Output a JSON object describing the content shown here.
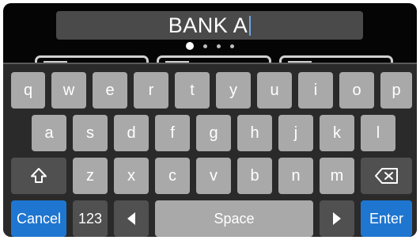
{
  "input": {
    "value": "BANK A"
  },
  "pagination": {
    "total": 4,
    "active": 1
  },
  "keyboard": {
    "row1": [
      "q",
      "w",
      "e",
      "r",
      "t",
      "y",
      "u",
      "i",
      "o",
      "p"
    ],
    "row2": [
      "a",
      "s",
      "d",
      "f",
      "g",
      "h",
      "j",
      "k",
      "l"
    ],
    "row3": [
      "z",
      "x",
      "c",
      "v",
      "b",
      "n",
      "m"
    ],
    "cancel_label": "Cancel",
    "numbers_label": "123",
    "space_label": "Space",
    "enter_label": "Enter"
  },
  "icons": {
    "shift": "shift-arrow-icon",
    "backspace": "backspace-icon",
    "left": "left-triangle-icon",
    "right": "right-triangle-icon"
  },
  "colors": {
    "key": "#a9a9a9",
    "key_dark": "#505050",
    "accent": "#1f76d0",
    "cursor": "#6fa8e6"
  }
}
